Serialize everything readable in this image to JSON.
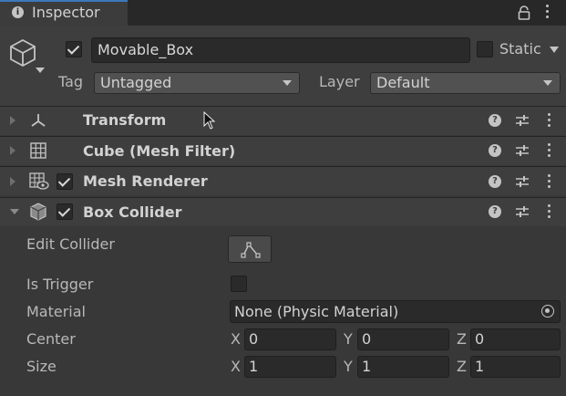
{
  "window": {
    "tab_title": "Inspector",
    "tab_icon": "info-icon"
  },
  "header": {
    "object_name": "Movable_Box",
    "active": true,
    "static_label": "Static",
    "static": false,
    "tag_label": "Tag",
    "tag_value": "Untagged",
    "layer_label": "Layer",
    "layer_value": "Default"
  },
  "components": [
    {
      "name": "Transform",
      "icon": "transform-icon",
      "expanded": false,
      "has_checkbox": false
    },
    {
      "name": "Cube (Mesh Filter)",
      "icon": "grid-icon",
      "expanded": false,
      "has_checkbox": false
    },
    {
      "name": "Mesh Renderer",
      "icon": "mesh-renderer-icon",
      "expanded": false,
      "has_checkbox": true,
      "enabled": true
    },
    {
      "name": "Box Collider",
      "icon": "box-collider-icon",
      "expanded": true,
      "has_checkbox": true,
      "enabled": true
    }
  ],
  "box_collider": {
    "edit_collider_label": "Edit Collider",
    "is_trigger_label": "Is Trigger",
    "is_trigger": false,
    "material_label": "Material",
    "material_value": "None (Physic Material)",
    "center_label": "Center",
    "center": {
      "x": "0",
      "y": "0",
      "z": "0"
    },
    "size_label": "Size",
    "size": {
      "x": "1",
      "y": "1",
      "z": "1"
    },
    "axis_labels": {
      "x": "X",
      "y": "Y",
      "z": "Z"
    }
  },
  "colors": {
    "background": "#383838",
    "header": "#3e3e3e",
    "field": "#2a2a2a",
    "tab_accent": "#3a79bb"
  }
}
